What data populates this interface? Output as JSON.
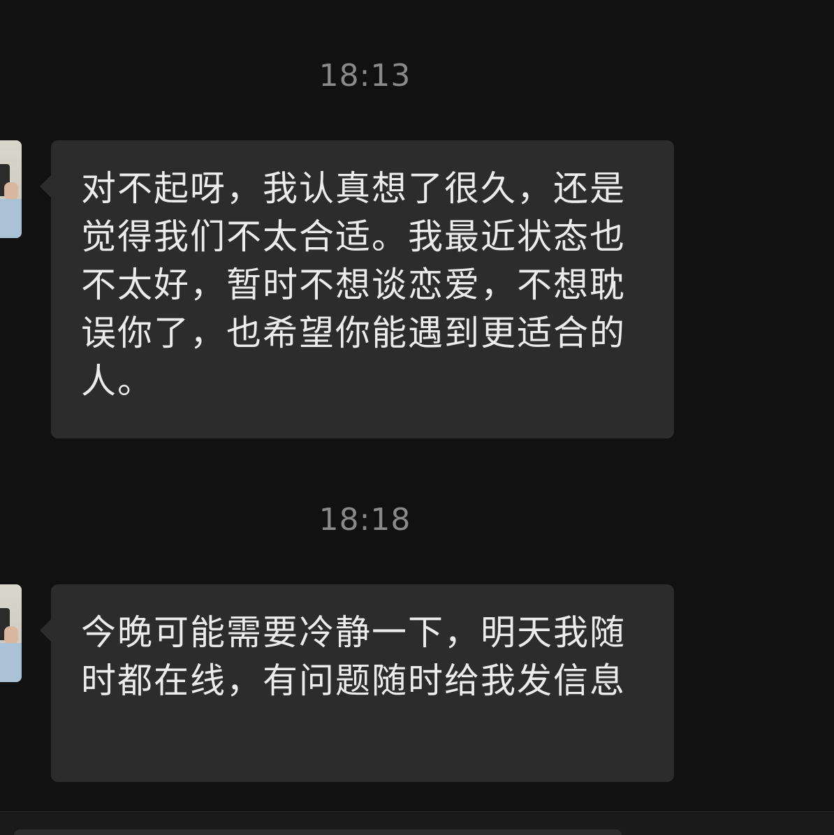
{
  "conversation": {
    "messages": [
      {
        "time": "18:13",
        "text": "对不起呀，我认真想了很久，还是觉得我们不太合适。我最近状态也不太好，暂时不想谈恋爱，不想耽误你了，也希望你能遇到更适合的人。"
      },
      {
        "time": "18:18",
        "text": "今晚可能需要冷静一下，明天我随时都在线，有问题随时给我发信息"
      }
    ]
  },
  "colors": {
    "background": "#111111",
    "bubble": "#2c2c2c",
    "text": "#ececec",
    "timestamp": "#8a8a8a"
  },
  "icons": {
    "avatar": "contact-avatar-photo"
  }
}
